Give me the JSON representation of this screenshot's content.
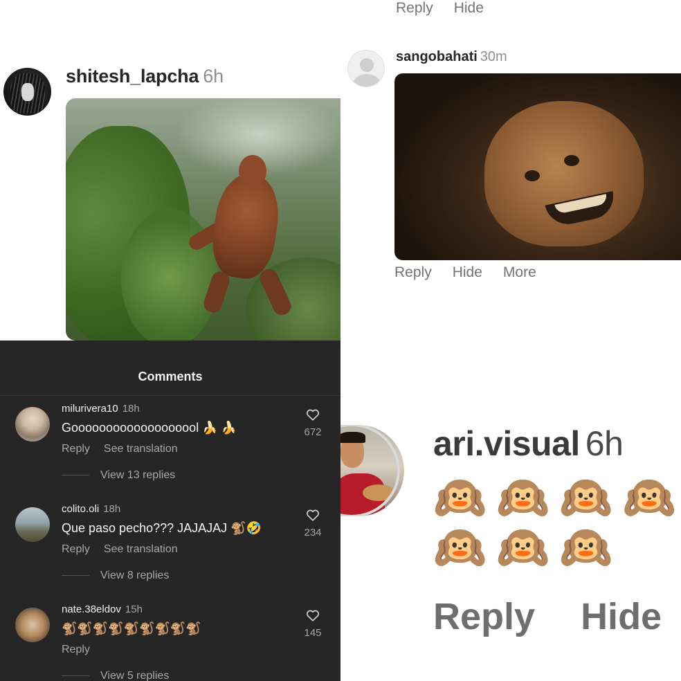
{
  "top_left": {
    "username": "shitesh_lapcha",
    "time": "6h"
  },
  "top_right": {
    "top_actions": [
      "Reply",
      "Hide"
    ],
    "username": "sangobahati",
    "time": "30m",
    "actions": [
      "Reply",
      "Hide",
      "More"
    ]
  },
  "comments_panel": {
    "title": "Comments",
    "comments": [
      {
        "username": "milurivera10",
        "time": "18h",
        "text": "Gooooooooooooooooool 🍌 🍌",
        "actions": [
          "Reply",
          "See translation"
        ],
        "replies": "View 13 replies",
        "likes": "672"
      },
      {
        "username": "colito.oli",
        "time": "18h",
        "text": "Que paso pecho??? JAJAJAJ 🐒🤣",
        "actions": [
          "Reply",
          "See translation"
        ],
        "replies": "View 8 replies",
        "likes": "234"
      },
      {
        "username": "nate.38eldov",
        "time": "15h",
        "text": "🐒🐒🐒🐒🐒🐒🐒🐒🐒",
        "actions": [
          "Reply"
        ],
        "replies": "View 5 replies",
        "likes": "145"
      }
    ],
    "icons": {
      "like": "heart-icon"
    }
  },
  "bottom_right": {
    "username": "ari.visual",
    "time": "6h",
    "emojis": "🙉🙉🙉🙉🙉🙉🙉",
    "actions": [
      "Reply",
      "Hide"
    ]
  }
}
